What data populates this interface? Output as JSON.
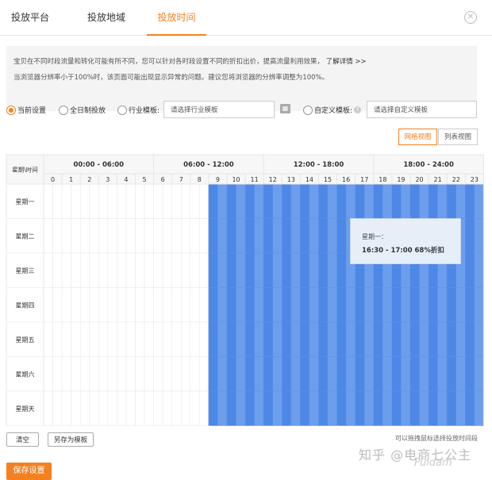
{
  "tabs": [
    {
      "label": "投放平台",
      "active": false
    },
    {
      "label": "投放地域",
      "active": false
    },
    {
      "label": "投放时间",
      "active": true
    }
  ],
  "close_icon": "close-circle-icon",
  "notice": {
    "line1": "宝贝在不同时段流量和转化可能有所不同，您可以针对各时段设置不同的折扣出价，提高流量利用效果，",
    "link": "了解详情 >>",
    "line2": "当浏览器分辨率小于100%时，该页面可能出现显示异常的问题。建议您将浏览器的分辨率调整为100%。"
  },
  "options": {
    "current_label": "当前设置",
    "allday_label": "全日制投放",
    "industry_label": "行业模板:",
    "industry_placeholder": "请选择行业模板",
    "custom_label": "自定义模板:",
    "custom_placeholder": "请选择自定义模板",
    "selected": "current"
  },
  "views": {
    "grid_label": "网格视图",
    "list_label": "列表视图",
    "active": "grid"
  },
  "schedule": {
    "corner_label": "星期\\时间",
    "ranges": [
      "00:00 - 06:00",
      "06:00 - 12:00",
      "12:00 - 18:00",
      "18:00 - 24:00"
    ],
    "hours": [
      "0",
      "1",
      "2",
      "3",
      "4",
      "5",
      "6",
      "7",
      "8",
      "9",
      "10",
      "11",
      "12",
      "13",
      "14",
      "15",
      "16",
      "17",
      "18",
      "19",
      "20",
      "21",
      "22",
      "23"
    ],
    "days": [
      "星期一",
      "星期二",
      "星期三",
      "星期四",
      "星期五",
      "星期六",
      "星期天"
    ],
    "active_start_hour": 9,
    "active_end_hour": 24,
    "colors": {
      "active_dark": "#4d88e6",
      "active_light": "#6c9eec",
      "inactive": "#ffffff",
      "line": "#e6e6e6",
      "header_bg": "#f7f7f7"
    }
  },
  "tooltip": {
    "title": "星期一：",
    "detail": "16:30 - 17:00  68%折扣"
  },
  "bottom": {
    "clear_label": "清空",
    "save_template_label": "另存为模板",
    "hint": "可以拖拽鼠标选择投放时间段",
    "save_label": "保存设置"
  },
  "watermark": {
    "text": "知乎 @电商七公主",
    "logo": "Fuldam"
  }
}
